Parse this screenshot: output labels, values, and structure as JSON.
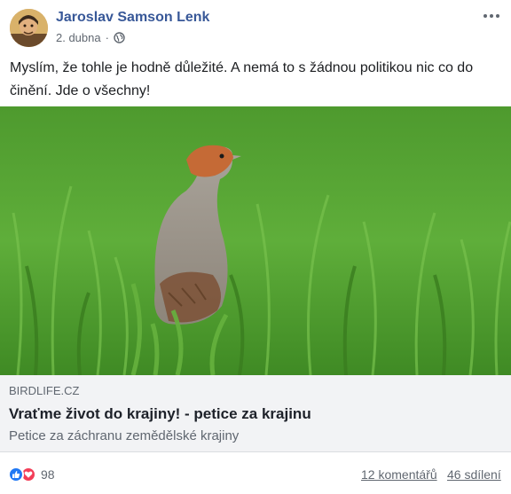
{
  "post": {
    "author": "Jaroslav Samson Lenk",
    "date": "2. dubna",
    "separator": "·",
    "privacy_icon": "globe-icon",
    "menu_icon": "more-options-icon",
    "text": "Myslím, že tohle je hodně důležité. A nemá to s žádnou politikou nic co do činění. Jde o všechny!"
  },
  "link_preview": {
    "image_icon": "partridge-photo",
    "domain": "BIRDLIFE.CZ",
    "title": "Vraťme život do krajiny! - petice za krajinu",
    "description": "Petice za záchranu zemědělské krajiny"
  },
  "footer": {
    "reaction_icons": [
      "like-icon",
      "love-icon"
    ],
    "reaction_count": "98",
    "comments": "12 komentářů",
    "shares": "46 sdílení"
  },
  "colors": {
    "author_link": "#385898",
    "meta_text": "#606770",
    "link_panel_bg": "#f2f3f5",
    "like_blue": "#2078f4",
    "love_red": "#f33e58",
    "grass_green": "#5aa83a"
  }
}
